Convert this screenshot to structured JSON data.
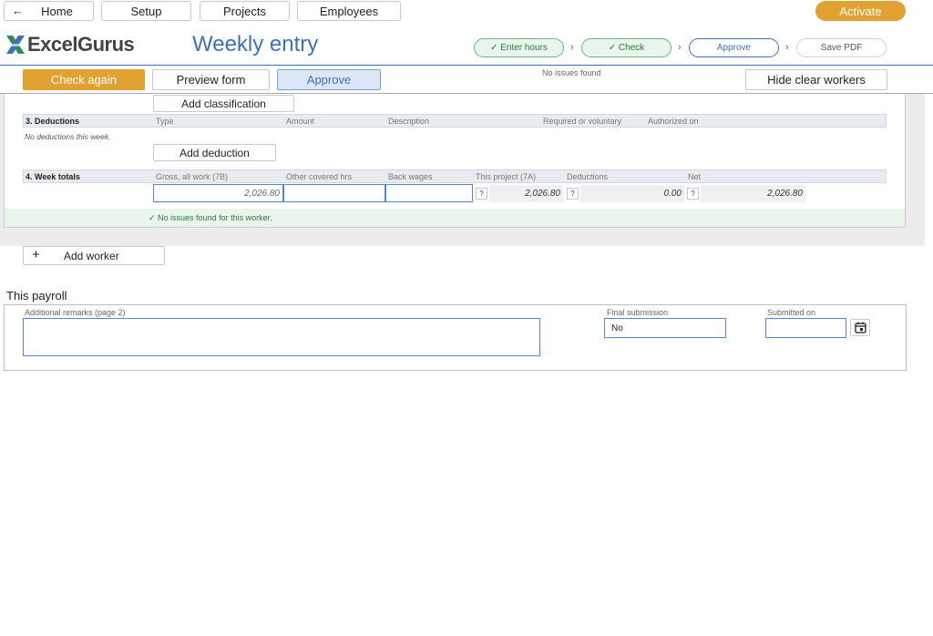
{
  "nav": {
    "home": "Home",
    "setup": "Setup",
    "projects": "Projects",
    "employees": "Employees",
    "activate": "Activate"
  },
  "brand": {
    "logo_text": "ExcelGurus"
  },
  "page": {
    "title": "Weekly entry"
  },
  "steps": {
    "enter_hours": "✓ Enter hours",
    "check": "✓ Check",
    "approve": "Approve",
    "save_pdf": "Save PDF",
    "chevron": "›"
  },
  "toolbar": {
    "check_again": "Check again",
    "preview_form": "Preview form",
    "approve": "Approve",
    "status": "No issues found",
    "hide_clear": "Hide clear workers"
  },
  "worker": {
    "add_classification": "Add classification",
    "deductions": {
      "title": "3. Deductions",
      "columns": [
        "Type",
        "Amount",
        "Description",
        "Required or voluntary",
        "Authorized on"
      ],
      "empty_note": "No deductions this week.",
      "add_button": "Add deduction"
    },
    "totals": {
      "title": "4. Week totals",
      "columns": [
        "Gross, all work (7B)",
        "Other covered hrs",
        "Back wages",
        "This project (7A)",
        "Deductions",
        "Net"
      ],
      "gross": "2,026.80",
      "other_hrs": "",
      "back_wages": "",
      "this_project": "2,026.80",
      "deductions": "0.00",
      "net": "2,026.80",
      "help": "?"
    },
    "ok_message": "✓  No issues found for this worker."
  },
  "add_worker": {
    "plus": "+",
    "label": "Add worker"
  },
  "payroll": {
    "title": "This payroll",
    "remarks_label": "Additional remarks (page 2)",
    "remarks_value": "",
    "final_label": "Final submission",
    "final_value": "No",
    "submitted_label": "Submitted on",
    "submitted_value": ""
  },
  "colors": {
    "accent_orange": "#e2a231",
    "accent_blue": "#3f6fbf",
    "success_green": "#2c7a3f"
  }
}
